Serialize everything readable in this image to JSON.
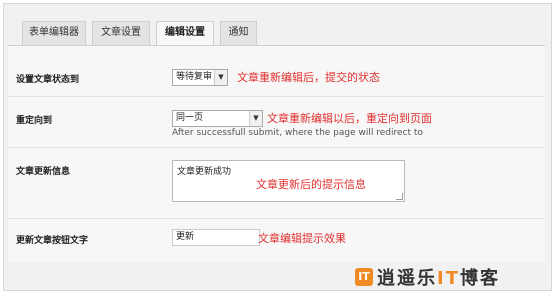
{
  "tabs": [
    {
      "label": "表单编辑器",
      "active": false
    },
    {
      "label": "文章设置",
      "active": false
    },
    {
      "label": "编辑设置",
      "active": true
    },
    {
      "label": "通知",
      "active": false
    }
  ],
  "rows": {
    "status": {
      "label": "设置文章状态到",
      "select_value": "等待复审",
      "annotation": "文章重新编辑后，提交的状态"
    },
    "redirect": {
      "label": "重定向到",
      "select_value": "同一页",
      "annotation": "文章重新编辑以后，重定向到页面",
      "help_text": "After successfull submit, where the page will redirect to"
    },
    "update_message": {
      "label": "文章更新信息",
      "textarea_value": "文章更新成功",
      "annotation": "文章更新后的提示信息"
    },
    "update_button": {
      "label": "更新文章按钮文字",
      "input_value": "更新",
      "annotation": "文章编辑提示效果"
    }
  },
  "watermark": {
    "icon_text": "IT",
    "text_prefix": "逍遥乐",
    "text_highlight": "IT",
    "text_suffix": "博客"
  },
  "colors": {
    "annotation": "#e0302f",
    "logo_accent": "#f08a24"
  }
}
